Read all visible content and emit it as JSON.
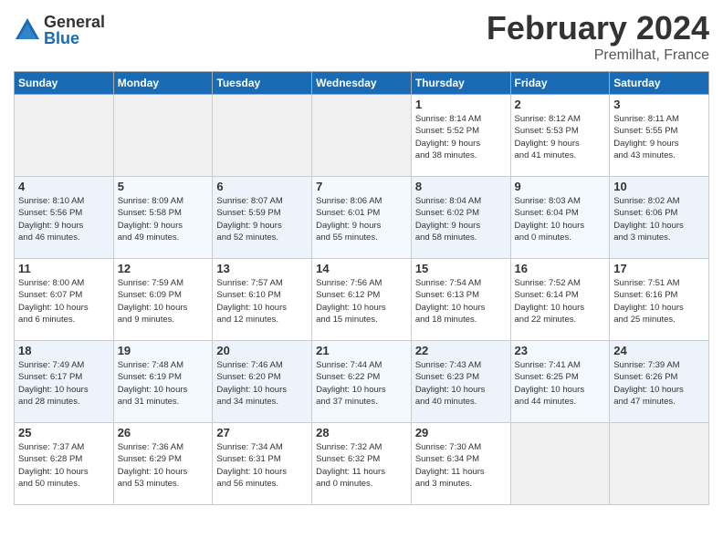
{
  "header": {
    "logo_general": "General",
    "logo_blue": "Blue",
    "title": "February 2024",
    "location": "Premilhat, France"
  },
  "columns": [
    "Sunday",
    "Monday",
    "Tuesday",
    "Wednesday",
    "Thursday",
    "Friday",
    "Saturday"
  ],
  "weeks": [
    {
      "days": [
        {
          "num": "",
          "info": ""
        },
        {
          "num": "",
          "info": ""
        },
        {
          "num": "",
          "info": ""
        },
        {
          "num": "",
          "info": ""
        },
        {
          "num": "1",
          "info": "Sunrise: 8:14 AM\nSunset: 5:52 PM\nDaylight: 9 hours\nand 38 minutes."
        },
        {
          "num": "2",
          "info": "Sunrise: 8:12 AM\nSunset: 5:53 PM\nDaylight: 9 hours\nand 41 minutes."
        },
        {
          "num": "3",
          "info": "Sunrise: 8:11 AM\nSunset: 5:55 PM\nDaylight: 9 hours\nand 43 minutes."
        }
      ]
    },
    {
      "days": [
        {
          "num": "4",
          "info": "Sunrise: 8:10 AM\nSunset: 5:56 PM\nDaylight: 9 hours\nand 46 minutes."
        },
        {
          "num": "5",
          "info": "Sunrise: 8:09 AM\nSunset: 5:58 PM\nDaylight: 9 hours\nand 49 minutes."
        },
        {
          "num": "6",
          "info": "Sunrise: 8:07 AM\nSunset: 5:59 PM\nDaylight: 9 hours\nand 52 minutes."
        },
        {
          "num": "7",
          "info": "Sunrise: 8:06 AM\nSunset: 6:01 PM\nDaylight: 9 hours\nand 55 minutes."
        },
        {
          "num": "8",
          "info": "Sunrise: 8:04 AM\nSunset: 6:02 PM\nDaylight: 9 hours\nand 58 minutes."
        },
        {
          "num": "9",
          "info": "Sunrise: 8:03 AM\nSunset: 6:04 PM\nDaylight: 10 hours\nand 0 minutes."
        },
        {
          "num": "10",
          "info": "Sunrise: 8:02 AM\nSunset: 6:06 PM\nDaylight: 10 hours\nand 3 minutes."
        }
      ]
    },
    {
      "days": [
        {
          "num": "11",
          "info": "Sunrise: 8:00 AM\nSunset: 6:07 PM\nDaylight: 10 hours\nand 6 minutes."
        },
        {
          "num": "12",
          "info": "Sunrise: 7:59 AM\nSunset: 6:09 PM\nDaylight: 10 hours\nand 9 minutes."
        },
        {
          "num": "13",
          "info": "Sunrise: 7:57 AM\nSunset: 6:10 PM\nDaylight: 10 hours\nand 12 minutes."
        },
        {
          "num": "14",
          "info": "Sunrise: 7:56 AM\nSunset: 6:12 PM\nDaylight: 10 hours\nand 15 minutes."
        },
        {
          "num": "15",
          "info": "Sunrise: 7:54 AM\nSunset: 6:13 PM\nDaylight: 10 hours\nand 18 minutes."
        },
        {
          "num": "16",
          "info": "Sunrise: 7:52 AM\nSunset: 6:14 PM\nDaylight: 10 hours\nand 22 minutes."
        },
        {
          "num": "17",
          "info": "Sunrise: 7:51 AM\nSunset: 6:16 PM\nDaylight: 10 hours\nand 25 minutes."
        }
      ]
    },
    {
      "days": [
        {
          "num": "18",
          "info": "Sunrise: 7:49 AM\nSunset: 6:17 PM\nDaylight: 10 hours\nand 28 minutes."
        },
        {
          "num": "19",
          "info": "Sunrise: 7:48 AM\nSunset: 6:19 PM\nDaylight: 10 hours\nand 31 minutes."
        },
        {
          "num": "20",
          "info": "Sunrise: 7:46 AM\nSunset: 6:20 PM\nDaylight: 10 hours\nand 34 minutes."
        },
        {
          "num": "21",
          "info": "Sunrise: 7:44 AM\nSunset: 6:22 PM\nDaylight: 10 hours\nand 37 minutes."
        },
        {
          "num": "22",
          "info": "Sunrise: 7:43 AM\nSunset: 6:23 PM\nDaylight: 10 hours\nand 40 minutes."
        },
        {
          "num": "23",
          "info": "Sunrise: 7:41 AM\nSunset: 6:25 PM\nDaylight: 10 hours\nand 44 minutes."
        },
        {
          "num": "24",
          "info": "Sunrise: 7:39 AM\nSunset: 6:26 PM\nDaylight: 10 hours\nand 47 minutes."
        }
      ]
    },
    {
      "days": [
        {
          "num": "25",
          "info": "Sunrise: 7:37 AM\nSunset: 6:28 PM\nDaylight: 10 hours\nand 50 minutes."
        },
        {
          "num": "26",
          "info": "Sunrise: 7:36 AM\nSunset: 6:29 PM\nDaylight: 10 hours\nand 53 minutes."
        },
        {
          "num": "27",
          "info": "Sunrise: 7:34 AM\nSunset: 6:31 PM\nDaylight: 10 hours\nand 56 minutes."
        },
        {
          "num": "28",
          "info": "Sunrise: 7:32 AM\nSunset: 6:32 PM\nDaylight: 11 hours\nand 0 minutes."
        },
        {
          "num": "29",
          "info": "Sunrise: 7:30 AM\nSunset: 6:34 PM\nDaylight: 11 hours\nand 3 minutes."
        },
        {
          "num": "",
          "info": ""
        },
        {
          "num": "",
          "info": ""
        }
      ]
    }
  ]
}
